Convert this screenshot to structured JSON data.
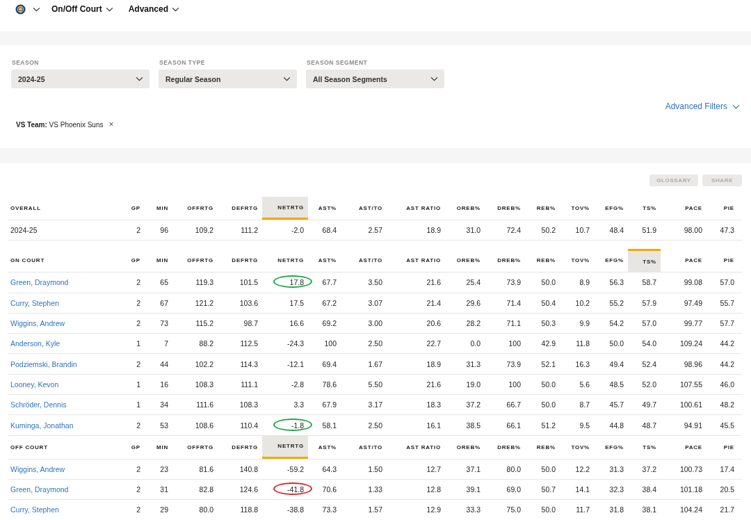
{
  "nav": {
    "items": [
      {
        "label": "On/Off Court"
      },
      {
        "label": "Advanced"
      }
    ]
  },
  "filters": [
    {
      "label": "SEASON",
      "value": "2024-25"
    },
    {
      "label": "SEASON TYPE",
      "value": "Regular Season"
    },
    {
      "label": "SEASON SEGMENT",
      "value": "All Season Segments"
    }
  ],
  "advanced_filters_link": "Advanced Filters",
  "active_filter": {
    "text": "**VS Team:** VS Phoenix Suns",
    "remove": "×"
  },
  "actions": [
    "GLOSSARY",
    "SHARE"
  ],
  "tables": [
    {
      "kind": "overall",
      "sort_ascending": false,
      "columns": [
        {
          "label": "OVERALL",
          "sorted": false
        },
        {
          "label": "GP",
          "sorted": false
        },
        {
          "label": "MIN",
          "sorted": false
        },
        {
          "label": "OFFRTG",
          "sorted": false
        },
        {
          "label": "DEFRTG",
          "sorted": false
        },
        {
          "label": "NETRTG",
          "sorted": true
        },
        {
          "label": "AST%",
          "sorted": false
        },
        {
          "label": "AST/TO",
          "sorted": false
        },
        {
          "label": "AST RATIO",
          "sorted": false
        },
        {
          "label": "OREB%",
          "sorted": false
        },
        {
          "label": "DREB%",
          "sorted": false
        },
        {
          "label": "REB%",
          "sorted": false
        },
        {
          "label": "TOV%",
          "sorted": false
        },
        {
          "label": "EFG%",
          "sorted": false
        },
        {
          "label": "TS%",
          "sorted": false
        },
        {
          "label": "PACE",
          "sorted": false
        },
        {
          "label": "PIE",
          "sorted": false
        }
      ],
      "rows": [
        {
          "cells": [
            "2024-25",
            "2",
            "96",
            "109.2",
            "111.2",
            "-2.0",
            "68.4",
            "2.57",
            "18.9",
            "31.0",
            "72.4",
            "50.2",
            "10.7",
            "48.4",
            "51.9",
            "98.00",
            "47.3"
          ]
        }
      ]
    },
    {
      "kind": "players",
      "sort_ascending": true,
      "columns": [
        {
          "label": "ON COURT",
          "sorted": false
        },
        {
          "label": "GP",
          "sorted": false
        },
        {
          "label": "MIN",
          "sorted": false
        },
        {
          "label": "OFFRTG",
          "sorted": false
        },
        {
          "label": "DEFRTG",
          "sorted": false
        },
        {
          "label": "NETRTG",
          "sorted": false
        },
        {
          "label": "AST%",
          "sorted": false
        },
        {
          "label": "AST/TO",
          "sorted": false
        },
        {
          "label": "AST RATIO",
          "sorted": false
        },
        {
          "label": "OREB%",
          "sorted": false
        },
        {
          "label": "DREB%",
          "sorted": false
        },
        {
          "label": "REB%",
          "sorted": false
        },
        {
          "label": "TOV%",
          "sorted": false
        },
        {
          "label": "EFG%",
          "sorted": false
        },
        {
          "label": "TS%",
          "sorted": true
        },
        {
          "label": "PACE",
          "sorted": false
        },
        {
          "label": "PIE",
          "sorted": false
        }
      ],
      "rows": [
        {
          "cells": [
            "Green, Draymond",
            "2",
            "65",
            "119.3",
            "101.5",
            {
              "text": "17.8",
              "color": "#22a845"
            },
            "67.7",
            "3.50",
            "21.6",
            "25.4",
            "73.9",
            "50.0",
            "8.9",
            "56.3",
            "58.7",
            "99.08",
            "57.0"
          ]
        },
        {
          "cells": [
            "Curry, Stephen",
            "2",
            "67",
            "121.2",
            "103.6",
            "17.5",
            "67.2",
            "3.07",
            "21.4",
            "29.6",
            "71.4",
            "50.4",
            "10.2",
            "55.2",
            "57.9",
            "97.49",
            "55.7"
          ]
        },
        {
          "cells": [
            "Wiggins, Andrew",
            "2",
            "73",
            "115.2",
            "98.7",
            "16.6",
            "69.2",
            "3.00",
            "20.6",
            "28.2",
            "71.1",
            "50.3",
            "9.9",
            "54.2",
            "57.0",
            "99.77",
            "57.7"
          ]
        },
        {
          "cells": [
            "Anderson, Kyle",
            "1",
            "7",
            "88.2",
            "112.5",
            "-24.3",
            "100",
            "2.50",
            "22.7",
            "0.0",
            "100",
            "42.9",
            "11.8",
            "50.0",
            "54.0",
            "109.24",
            "44.2"
          ]
        },
        {
          "cells": [
            "Podziemski, Brandin",
            "2",
            "44",
            "102.2",
            "114.3",
            "-12.1",
            "69.4",
            "1.67",
            "18.9",
            "31.3",
            "73.9",
            "52.1",
            "16.3",
            "49.4",
            "52.4",
            "98.96",
            "44.2"
          ]
        },
        {
          "cells": [
            "Looney, Kevon",
            "1",
            "16",
            "108.3",
            "111.1",
            "-2.8",
            "78.6",
            "5.50",
            "21.6",
            "19.0",
            "100",
            "50.0",
            "5.6",
            "48.5",
            "52.0",
            "107.55",
            "46.0"
          ]
        },
        {
          "cells": [
            "Schröder, Dennis",
            "1",
            "34",
            "111.6",
            "108.3",
            "3.3",
            "67.9",
            "3.17",
            "18.3",
            "37.2",
            "66.7",
            "50.0",
            "8.7",
            "45.7",
            "49.7",
            "100.61",
            "48.2"
          ]
        },
        {
          "cells": [
            "Kuminga, Jonathan",
            "2",
            "53",
            "108.6",
            "110.4",
            {
              "text": "-1.8",
              "color": "#22a845"
            },
            "58.1",
            "2.50",
            "16.1",
            "38.5",
            "66.1",
            "51.2",
            "9.5",
            "44.8",
            "48.7",
            "94.91",
            "45.5"
          ]
        }
      ]
    },
    {
      "kind": "players",
      "sort_ascending": false,
      "columns": [
        {
          "label": "OFF COURT",
          "sorted": false
        },
        {
          "label": "GP",
          "sorted": false
        },
        {
          "label": "MIN",
          "sorted": false
        },
        {
          "label": "OFFRTG",
          "sorted": false
        },
        {
          "label": "DEFRTG",
          "sorted": false
        },
        {
          "label": "NETRTG",
          "sorted": true
        },
        {
          "label": "AST%",
          "sorted": false
        },
        {
          "label": "AST/TO",
          "sorted": false
        },
        {
          "label": "AST RATIO",
          "sorted": false
        },
        {
          "label": "OREB%",
          "sorted": false
        },
        {
          "label": "DREB%",
          "sorted": false
        },
        {
          "label": "REB%",
          "sorted": false
        },
        {
          "label": "TOV%",
          "sorted": false
        },
        {
          "label": "EFG%",
          "sorted": false
        },
        {
          "label": "TS%",
          "sorted": false
        },
        {
          "label": "PACE",
          "sorted": false
        },
        {
          "label": "PIE",
          "sorted": false
        }
      ],
      "rows": [
        {
          "cells": [
            "Wiggins, Andrew",
            "2",
            "23",
            "81.6",
            "140.8",
            "-59.2",
            "64.3",
            "1.50",
            "12.7",
            "37.1",
            "80.0",
            "50.0",
            "12.2",
            "31.3",
            "37.2",
            "100.73",
            "17.4"
          ]
        },
        {
          "cells": [
            "Green, Draymond",
            "2",
            "31",
            "82.8",
            "124.6",
            {
              "text": "-41.8",
              "color": "#e0262d"
            },
            "70.6",
            "1.33",
            "12.8",
            "39.1",
            "69.0",
            "50.7",
            "14.1",
            "32.3",
            "38.4",
            "101.18",
            "20.5"
          ]
        },
        {
          "cells": [
            "Curry, Stephen",
            "2",
            "29",
            "80.0",
            "118.8",
            "-38.8",
            "73.3",
            "1.57",
            "12.9",
            "33.3",
            "75.0",
            "50.0",
            "11.7",
            "31.8",
            "38.1",
            "104.24",
            "21.7"
          ]
        }
      ]
    }
  ]
}
